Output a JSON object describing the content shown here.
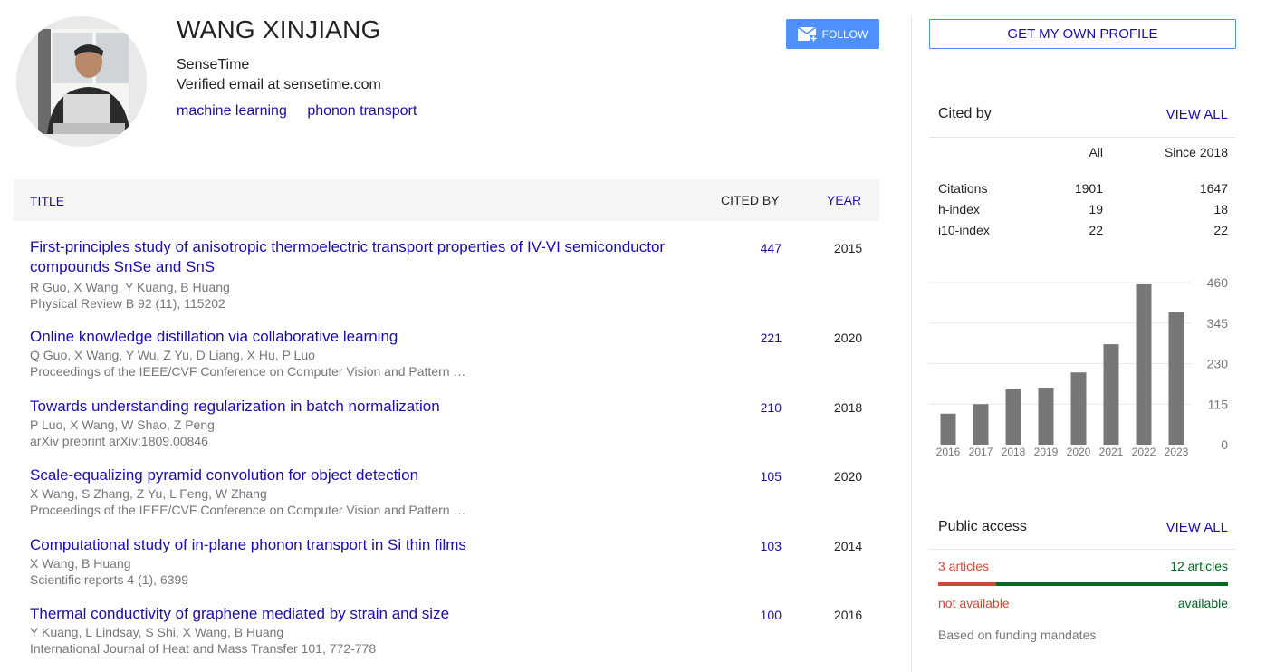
{
  "profile": {
    "name": "WANG XINJIANG",
    "affiliation": "SenseTime",
    "email": "Verified email at sensetime.com",
    "interests": [
      "machine learning",
      "phonon transport"
    ],
    "follow_label": "FOLLOW"
  },
  "table": {
    "headers": {
      "title": "TITLE",
      "cited_by": "CITED BY",
      "year": "YEAR"
    },
    "rows": [
      {
        "title": "First-principles study of anisotropic thermoelectric transport properties of IV-VI semiconductor compounds SnSe and SnS",
        "authors": "R Guo, X Wang, Y Kuang, B Huang",
        "venue": "Physical Review B 92 (11), 115202",
        "cited_by": "447",
        "year": "2015"
      },
      {
        "title": "Online knowledge distillation via collaborative learning",
        "authors": "Q Guo, X Wang, Y Wu, Z Yu, D Liang, X Hu, P Luo",
        "venue": "Proceedings of the IEEE/CVF Conference on Computer Vision and Pattern …",
        "cited_by": "221",
        "year": "2020"
      },
      {
        "title": "Towards understanding regularization in batch normalization",
        "authors": "P Luo, X Wang, W Shao, Z Peng",
        "venue": "arXiv preprint arXiv:1809.00846",
        "cited_by": "210",
        "year": "2018"
      },
      {
        "title": "Scale-equalizing pyramid convolution for object detection",
        "authors": "X Wang, S Zhang, Z Yu, L Feng, W Zhang",
        "venue": "Proceedings of the IEEE/CVF Conference on Computer Vision and Pattern …",
        "cited_by": "105",
        "year": "2020"
      },
      {
        "title": "Computational study of in-plane phonon transport in Si thin films",
        "authors": "X Wang, B Huang",
        "venue": "Scientific reports 4 (1), 6399",
        "cited_by": "103",
        "year": "2014"
      },
      {
        "title": "Thermal conductivity of graphene mediated by strain and size",
        "authors": "Y Kuang, L Lindsay, S Shi, X Wang, B Huang",
        "venue": "International Journal of Heat and Mass Transfer 101, 772-778",
        "cited_by": "100",
        "year": "2016"
      }
    ]
  },
  "sidebar": {
    "own_profile_label": "GET MY OWN PROFILE",
    "cited_by": {
      "label": "Cited by",
      "view_all": "VIEW ALL",
      "col_all": "All",
      "col_since": "Since 2018",
      "stats": [
        {
          "label": "Citations",
          "all": "1901",
          "since": "1647"
        },
        {
          "label": "h-index",
          "all": "19",
          "since": "18"
        },
        {
          "label": "i10-index",
          "all": "22",
          "since": "22"
        }
      ]
    },
    "public_access": {
      "label": "Public access",
      "view_all": "VIEW ALL",
      "not_available_count": "3 articles",
      "available_count": "12 articles",
      "not_available_label": "not available",
      "available_label": "available",
      "not_available_fraction": 0.2,
      "mandates": "Based on funding mandates"
    }
  },
  "colors": {
    "link": "#1a0dab",
    "follow_button": "#4d90fe",
    "bar": "#777777",
    "not_available": "#d14836",
    "available": "#006621"
  },
  "chart_data": {
    "type": "bar",
    "categories": [
      "2016",
      "2017",
      "2018",
      "2019",
      "2020",
      "2021",
      "2022",
      "2023"
    ],
    "values": [
      88,
      115,
      157,
      162,
      205,
      285,
      455,
      377
    ],
    "ylim": [
      0,
      460
    ],
    "yticks": [
      "0",
      "115",
      "230",
      "345",
      "460"
    ],
    "grid": true
  }
}
